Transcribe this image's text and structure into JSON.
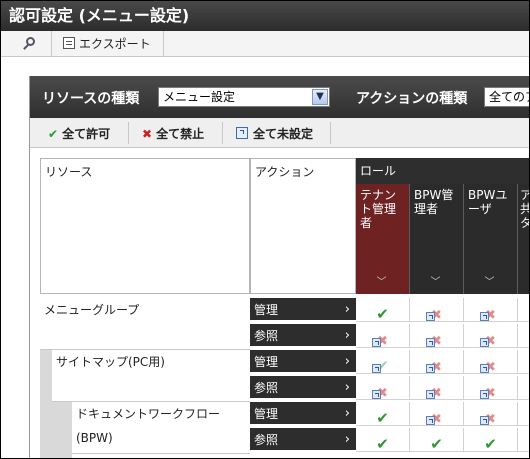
{
  "window": {
    "title": "認可設定 (メニュー設定)"
  },
  "toolbar": {
    "search_icon": "search-icon",
    "export_label": "エクスポート"
  },
  "filter": {
    "resource_type_label": "リソースの種類",
    "resource_type_value": "メニュー設定",
    "action_type_label": "アクションの種類",
    "action_type_value": "全てのア"
  },
  "actions": {
    "allow_all": "全て許可",
    "deny_all": "全て禁止",
    "unset_all": "全て未設定"
  },
  "grid": {
    "col_resource": "リソース",
    "col_action": "アクション",
    "col_role": "ロール",
    "roles": [
      {
        "label": "テナント管理者"
      },
      {
        "label": "BPW管理者"
      },
      {
        "label": "BPWユーザ"
      },
      {
        "label": "ア共タ"
      }
    ],
    "resources": [
      {
        "name": "メニューグループ",
        "level": 0
      },
      {
        "name": "サイトマップ(PC用)",
        "level": 1
      },
      {
        "name": "ドキュメントワークフロー(BPW)",
        "level": 2
      }
    ],
    "rows": [
      {
        "action": "管理",
        "perms": [
          "allow",
          "inherit-deny",
          "inherit-deny"
        ]
      },
      {
        "action": "参照",
        "perms": [
          "inherit-deny",
          "inherit-deny",
          "inherit-deny"
        ]
      },
      {
        "action": "管理",
        "perms": [
          "inherit-allow",
          "inherit-deny",
          "inherit-deny"
        ]
      },
      {
        "action": "参照",
        "perms": [
          "inherit-deny",
          "inherit-deny",
          "inherit-deny"
        ]
      },
      {
        "action": "管理",
        "perms": [
          "allow",
          "inherit-deny",
          "inherit-deny"
        ]
      },
      {
        "action": "参照",
        "perms": [
          "allow",
          "allow",
          "allow"
        ]
      }
    ]
  },
  "colors": {
    "active_role": "#6e2222",
    "allow": "#2b9a2b",
    "deny": "#e58a8a"
  }
}
